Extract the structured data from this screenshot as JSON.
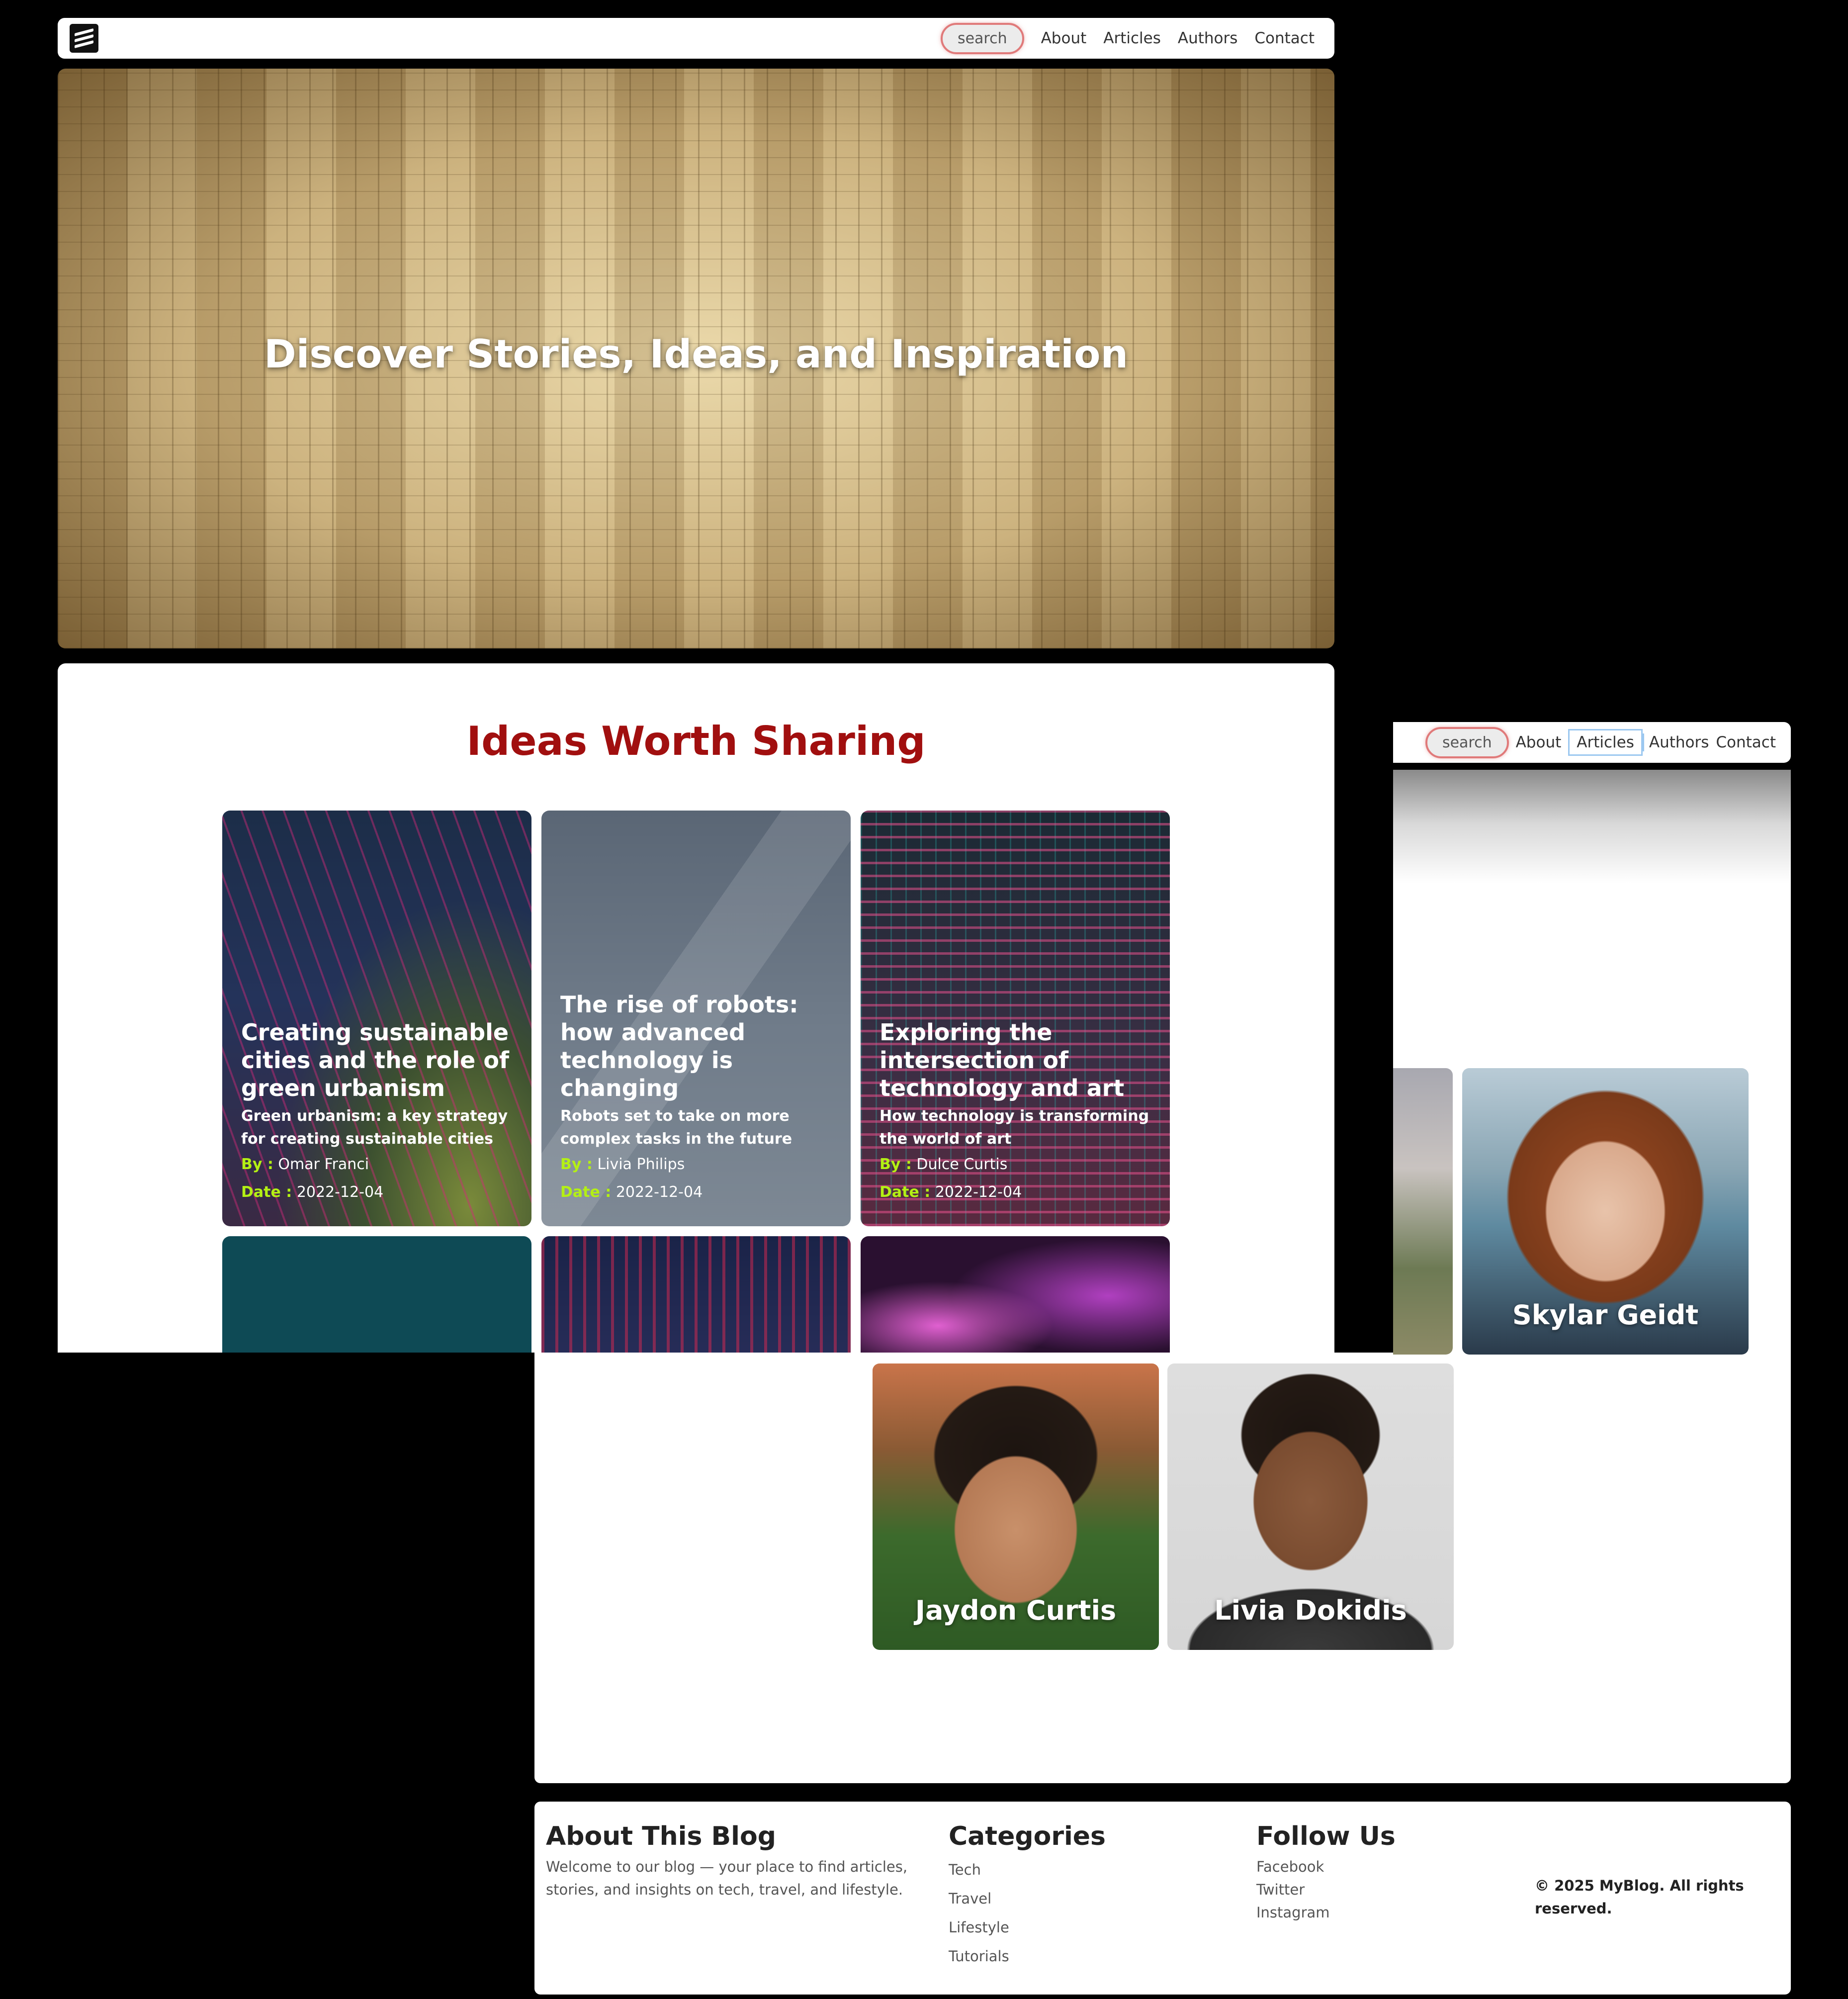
{
  "nav": {
    "search_label": "search",
    "links": [
      "About",
      "Articles",
      "Authors",
      "Contact"
    ]
  },
  "hero": {
    "title": "Discover Stories, Ideas, and Inspiration"
  },
  "articles_section": {
    "title": "Ideas Worth Sharing",
    "by_key": "By :",
    "date_key": "Date :",
    "cards": [
      {
        "title": "Creating sustainable cities and the role of green urbanism",
        "subtitle": "Green urbanism: a key strategy for creating sustainable cities",
        "author": "Omar Franci",
        "date": "2022-12-04"
      },
      {
        "title": "The rise of robots: how advanced technology is changing",
        "subtitle": "Robots set to take on more complex tasks in the future",
        "author": "Livia Philips",
        "date": "2022-12-04"
      },
      {
        "title": "Exploring the intersection of technology and art",
        "subtitle": "How technology is transforming the world of art",
        "author": "Dulce Curtis",
        "date": "2022-12-04"
      }
    ]
  },
  "authors": [
    {
      "name": "Skylar Geidt"
    },
    {
      "name": "Jaydon Curtis"
    },
    {
      "name": "Livia Dokidis"
    }
  ],
  "footer": {
    "about_title": "About This Blog",
    "about_text_1": "Welcome to our blog — your place to find articles,",
    "about_text_2": "stories, and insights on tech, travel, and lifestyle.",
    "categories_title": "Categories",
    "categories": [
      "Tech",
      "Travel",
      "Lifestyle",
      "Tutorials"
    ],
    "follow_title": "Follow Us",
    "social": [
      "Facebook",
      "Twitter",
      "Instagram"
    ],
    "copyright_1": "© 2025 MyBlog. All rights",
    "copyright_2": "reserved."
  }
}
